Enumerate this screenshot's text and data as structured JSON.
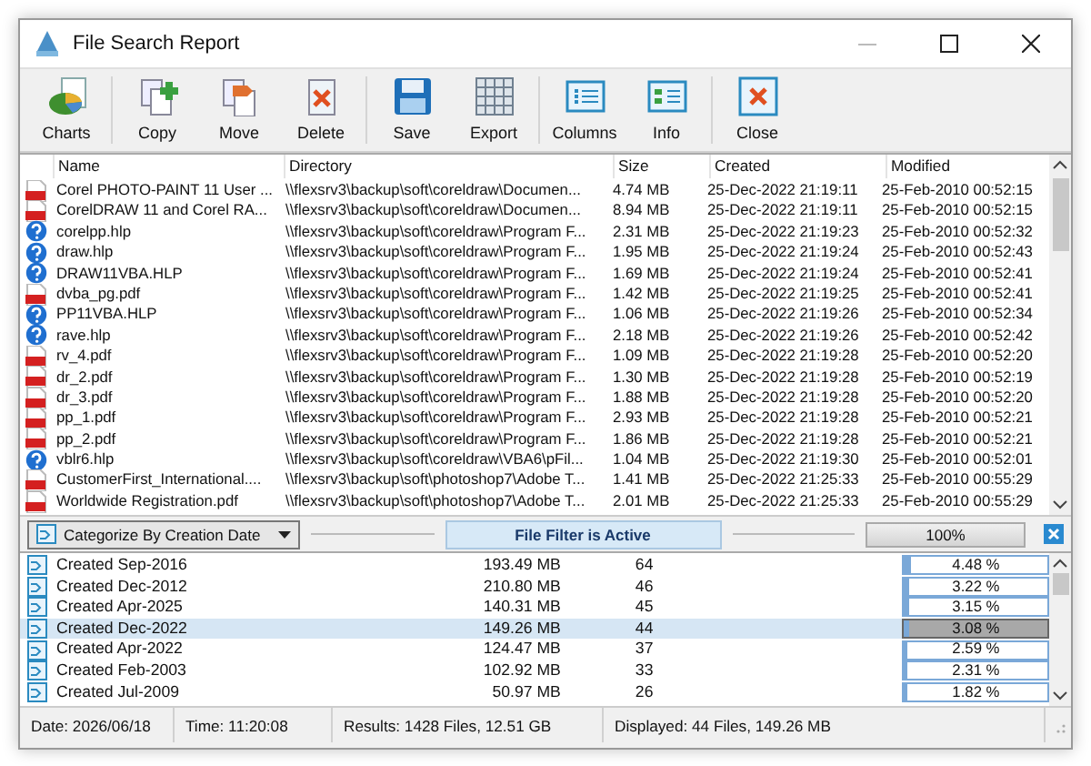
{
  "window": {
    "title": "File Search Report"
  },
  "toolbar": [
    {
      "kind": "charts",
      "label": "Charts"
    },
    {
      "kind": "copy",
      "label": "Copy"
    },
    {
      "kind": "move",
      "label": "Move"
    },
    {
      "kind": "delete",
      "label": "Delete"
    },
    {
      "kind": "save",
      "label": "Save"
    },
    {
      "kind": "export",
      "label": "Export"
    },
    {
      "kind": "columns",
      "label": "Columns"
    },
    {
      "kind": "info",
      "label": "Info"
    },
    {
      "kind": "close",
      "label": "Close"
    }
  ],
  "table": {
    "columns": [
      "Name",
      "Directory",
      "Size",
      "Created",
      "Modified"
    ],
    "rows": [
      {
        "kind": "pdf",
        "cells": [
          "Corel PHOTO-PAINT 11 User ...",
          "\\\\flexsrv3\\backup\\soft\\coreldraw\\Documen...",
          "4.74 MB",
          "25-Dec-2022 21:19:11",
          "25-Feb-2010 00:52:15"
        ]
      },
      {
        "kind": "pdf",
        "cells": [
          "CorelDRAW 11 and Corel RA...",
          "\\\\flexsrv3\\backup\\soft\\coreldraw\\Documen...",
          "8.94 MB",
          "25-Dec-2022 21:19:11",
          "25-Feb-2010 00:52:15"
        ]
      },
      {
        "kind": "help",
        "cells": [
          "corelpp.hlp",
          "\\\\flexsrv3\\backup\\soft\\coreldraw\\Program F...",
          "2.31 MB",
          "25-Dec-2022 21:19:23",
          "25-Feb-2010 00:52:32"
        ]
      },
      {
        "kind": "help",
        "cells": [
          "draw.hlp",
          "\\\\flexsrv3\\backup\\soft\\coreldraw\\Program F...",
          "1.95 MB",
          "25-Dec-2022 21:19:24",
          "25-Feb-2010 00:52:43"
        ]
      },
      {
        "kind": "help",
        "cells": [
          "DRAW11VBA.HLP",
          "\\\\flexsrv3\\backup\\soft\\coreldraw\\Program F...",
          "1.69 MB",
          "25-Dec-2022 21:19:24",
          "25-Feb-2010 00:52:41"
        ]
      },
      {
        "kind": "pdf",
        "cells": [
          "dvba_pg.pdf",
          "\\\\flexsrv3\\backup\\soft\\coreldraw\\Program F...",
          "1.42 MB",
          "25-Dec-2022 21:19:25",
          "25-Feb-2010 00:52:41"
        ]
      },
      {
        "kind": "help",
        "cells": [
          "PP11VBA.HLP",
          "\\\\flexsrv3\\backup\\soft\\coreldraw\\Program F...",
          "1.06 MB",
          "25-Dec-2022 21:19:26",
          "25-Feb-2010 00:52:34"
        ]
      },
      {
        "kind": "help",
        "cells": [
          "rave.hlp",
          "\\\\flexsrv3\\backup\\soft\\coreldraw\\Program F...",
          "2.18 MB",
          "25-Dec-2022 21:19:26",
          "25-Feb-2010 00:52:42"
        ]
      },
      {
        "kind": "pdf",
        "cells": [
          "rv_4.pdf",
          "\\\\flexsrv3\\backup\\soft\\coreldraw\\Program F...",
          "1.09 MB",
          "25-Dec-2022 21:19:28",
          "25-Feb-2010 00:52:20"
        ]
      },
      {
        "kind": "pdf",
        "cells": [
          "dr_2.pdf",
          "\\\\flexsrv3\\backup\\soft\\coreldraw\\Program F...",
          "1.30 MB",
          "25-Dec-2022 21:19:28",
          "25-Feb-2010 00:52:19"
        ]
      },
      {
        "kind": "pdf",
        "cells": [
          "dr_3.pdf",
          "\\\\flexsrv3\\backup\\soft\\coreldraw\\Program F...",
          "1.88 MB",
          "25-Dec-2022 21:19:28",
          "25-Feb-2010 00:52:20"
        ]
      },
      {
        "kind": "pdf",
        "cells": [
          "pp_1.pdf",
          "\\\\flexsrv3\\backup\\soft\\coreldraw\\Program F...",
          "2.93 MB",
          "25-Dec-2022 21:19:28",
          "25-Feb-2010 00:52:21"
        ]
      },
      {
        "kind": "pdf",
        "cells": [
          "pp_2.pdf",
          "\\\\flexsrv3\\backup\\soft\\coreldraw\\Program F...",
          "1.86 MB",
          "25-Dec-2022 21:19:28",
          "25-Feb-2010 00:52:21"
        ]
      },
      {
        "kind": "help",
        "cells": [
          "vblr6.hlp",
          "\\\\flexsrv3\\backup\\soft\\coreldraw\\VBA6\\pFil...",
          "1.04 MB",
          "25-Dec-2022 21:19:30",
          "25-Feb-2010 00:52:01"
        ]
      },
      {
        "kind": "pdf",
        "cells": [
          "CustomerFirst_International....",
          "\\\\flexsrv3\\backup\\soft\\photoshop7\\Adobe T...",
          "1.41 MB",
          "25-Dec-2022 21:25:33",
          "25-Feb-2010 00:55:29"
        ]
      },
      {
        "kind": "pdf",
        "cells": [
          "Worldwide Registration.pdf",
          "\\\\flexsrv3\\backup\\soft\\photoshop7\\Adobe T...",
          "2.01 MB",
          "25-Dec-2022 21:25:33",
          "25-Feb-2010 00:55:29"
        ]
      }
    ]
  },
  "category_bar": {
    "dropdown": "Categorize By Creation Date",
    "filter": "File Filter is Active",
    "progress": "100%",
    "level": 1
  },
  "categories": [
    {
      "name": "Created Sep-2016",
      "size": "193.49 MB",
      "count": "64",
      "level": 0.0448,
      "percent": "4.48 %",
      "selected": false
    },
    {
      "name": "Created Dec-2012",
      "size": "210.80 MB",
      "count": "46",
      "level": 0.0322,
      "percent": "3.22 %",
      "selected": false
    },
    {
      "name": "Created Apr-2025",
      "size": "140.31 MB",
      "count": "45",
      "level": 0.0315,
      "percent": "3.15 %",
      "selected": false
    },
    {
      "name": "Created Dec-2022",
      "size": "149.26 MB",
      "count": "44",
      "level": 0.0308,
      "percent": "3.08 %",
      "selected": true
    },
    {
      "name": "Created Apr-2022",
      "size": "124.47 MB",
      "count": "37",
      "level": 0.0259,
      "percent": "2.59 %",
      "selected": false
    },
    {
      "name": "Created Feb-2003",
      "size": "102.92 MB",
      "count": "33",
      "level": 0.0231,
      "percent": "2.31 %",
      "selected": false
    },
    {
      "name": "Created Jul-2009",
      "size": "50.97 MB",
      "count": "26",
      "level": 0.0182,
      "percent": "1.82 %",
      "selected": false
    }
  ],
  "status_bar": [
    "Date: 2026/06/18",
    "Time: 11:20:08",
    "Results: 1428 Files, 12.51 GB",
    "Displayed: 44 Files, 149.26 MB"
  ]
}
